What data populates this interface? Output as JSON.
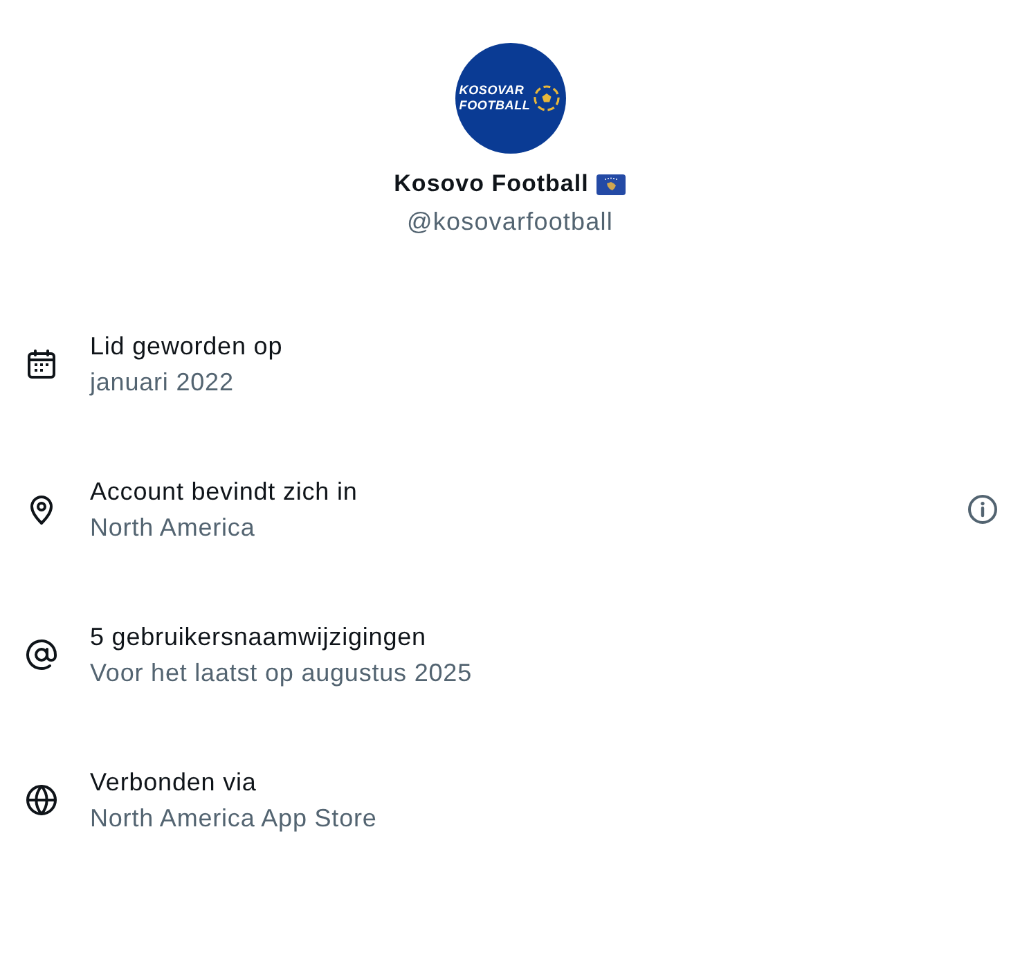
{
  "profile": {
    "avatar": {
      "logo_lines": [
        "KOSOVAR",
        "FOOTBALL"
      ]
    },
    "name": "Kosovo Football",
    "handle": "@kosovarfootball"
  },
  "details": [
    {
      "kind": "calendar",
      "title": "Lid geworden op",
      "value": "januari 2022",
      "info": false
    },
    {
      "kind": "location",
      "title": "Account bevindt zich in",
      "value": "North America",
      "info": true
    },
    {
      "kind": "at",
      "title": "5 gebruikersnaamwijzigingen",
      "value": "Voor het laatst op augustus 2025",
      "info": false
    },
    {
      "kind": "globe",
      "title": "Verbonden via",
      "value": "North America App Store",
      "info": false
    }
  ]
}
